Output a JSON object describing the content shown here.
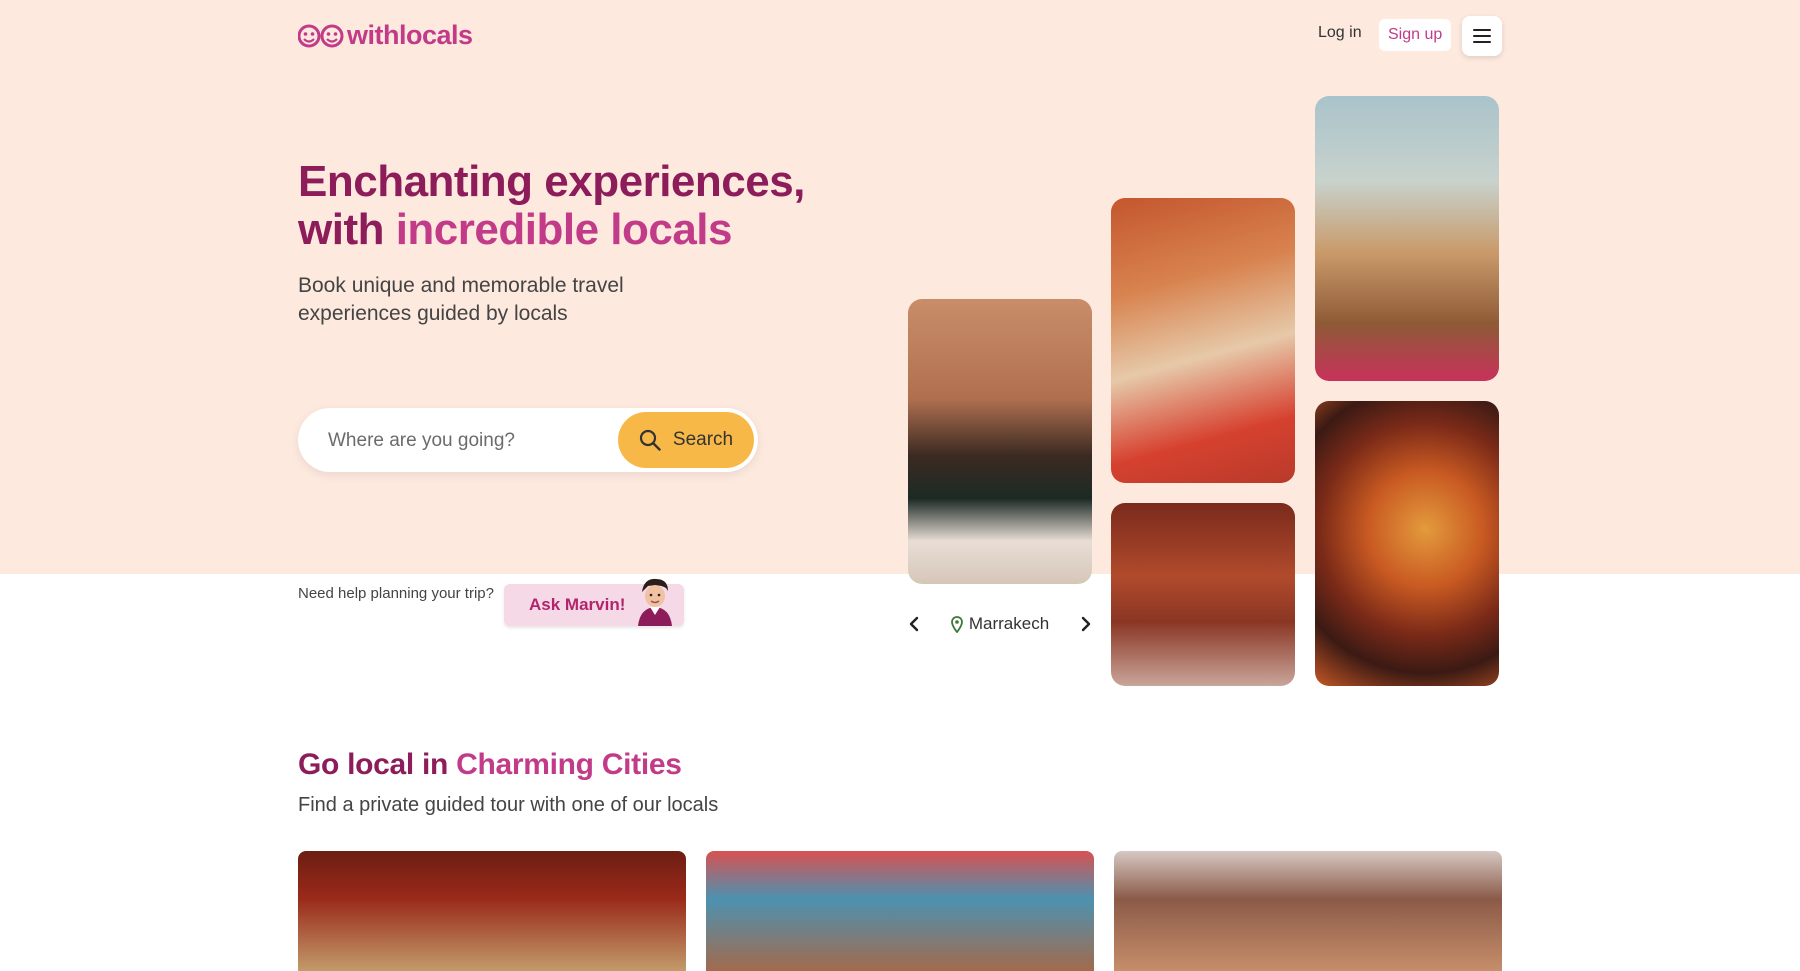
{
  "header": {
    "brand": "withlocals",
    "login_label": "Log in",
    "signup_label": "Sign up"
  },
  "hero": {
    "title_line1": "Enchanting experiences,",
    "title_line2_prefix": "with ",
    "title_line2_highlight": "incredible locals",
    "subtitle": "Book unique and memorable travel experiences guided by locals"
  },
  "search": {
    "placeholder": "Where are you going?",
    "value": "",
    "button_label": "Search"
  },
  "help": {
    "text": "Need help planning your trip?",
    "button_label": "Ask Marvin!"
  },
  "carousel": {
    "city": "Marrakech"
  },
  "cities_section": {
    "title_prefix": "Go local in ",
    "title_highlight": "Charming Cities",
    "subtitle": "Find a private guided tour with one of our locals"
  },
  "colors": {
    "hero_background": "#fde9de",
    "brand": "#c13b89",
    "heading": "#8c1c5a",
    "search_button": "#f7b847"
  }
}
